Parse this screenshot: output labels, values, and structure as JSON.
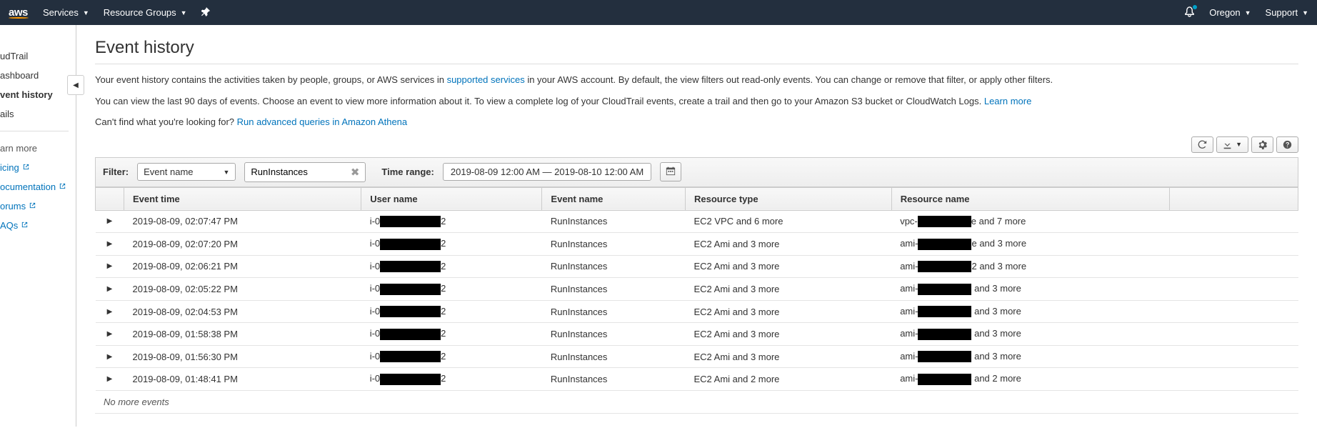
{
  "navbar": {
    "logo": "aws",
    "services": "Services",
    "resource_groups": "Resource Groups",
    "region": "Oregon",
    "support": "Support"
  },
  "sidebar": {
    "service_title": "udTrail",
    "dashboard": "ashboard",
    "event_history": "vent history",
    "trails": "ails",
    "learn_more": "arn more",
    "pricing": "icing",
    "documentation": "ocumentation",
    "forums": "orums",
    "faqs": "AQs"
  },
  "page": {
    "title": "Event history",
    "desc1_a": "Your event history contains the activities taken by people, groups, or AWS services in ",
    "desc1_link": "supported services",
    "desc1_b": " in your AWS account. By default, the view filters out read-only events. You can change or remove that filter, or apply other filters.",
    "desc2_a": "You can view the last 90 days of events. Choose an event to view more information about it. To view a complete log of your CloudTrail events, create a trail and then go to your Amazon S3 bucket or CloudWatch Logs. ",
    "desc2_link": "Learn more",
    "desc3_a": "Can't find what you're looking for? ",
    "desc3_link": "Run advanced queries in Amazon Athena"
  },
  "filter": {
    "label": "Filter:",
    "attribute": "Event name",
    "value": "RunInstances",
    "timerange_label": "Time range:",
    "timerange_value": "2019-08-09 12:00 AM — 2019-08-10 12:00 AM"
  },
  "table": {
    "headers": {
      "event_time": "Event time",
      "user_name": "User name",
      "event_name": "Event name",
      "resource_type": "Resource type",
      "resource_name": "Resource name"
    },
    "rows": [
      {
        "time": "2019-08-09, 02:07:47 PM",
        "user_pre": "i-0",
        "user_post": "2",
        "event": "RunInstances",
        "rtype": "EC2 VPC and 6 more",
        "rname_pre": "vpc-",
        "rname_post": "e and 7 more"
      },
      {
        "time": "2019-08-09, 02:07:20 PM",
        "user_pre": "i-0",
        "user_post": "2",
        "event": "RunInstances",
        "rtype": "EC2 Ami and 3 more",
        "rname_pre": "ami-",
        "rname_post": "e and 3 more"
      },
      {
        "time": "2019-08-09, 02:06:21 PM",
        "user_pre": "i-0",
        "user_post": "2",
        "event": "RunInstances",
        "rtype": "EC2 Ami and 3 more",
        "rname_pre": "ami-",
        "rname_post": "2 and 3 more"
      },
      {
        "time": "2019-08-09, 02:05:22 PM",
        "user_pre": "i-0",
        "user_post": "2",
        "event": "RunInstances",
        "rtype": "EC2 Ami and 3 more",
        "rname_pre": "ami-",
        "rname_post": " and 3 more"
      },
      {
        "time": "2019-08-09, 02:04:53 PM",
        "user_pre": "i-0",
        "user_post": "2",
        "event": "RunInstances",
        "rtype": "EC2 Ami and 3 more",
        "rname_pre": "ami-",
        "rname_post": " and 3 more"
      },
      {
        "time": "2019-08-09, 01:58:38 PM",
        "user_pre": "i-0",
        "user_post": "2",
        "event": "RunInstances",
        "rtype": "EC2 Ami and 3 more",
        "rname_pre": "ami-",
        "rname_post": " and 3 more"
      },
      {
        "time": "2019-08-09, 01:56:30 PM",
        "user_pre": "i-0",
        "user_post": "2",
        "event": "RunInstances",
        "rtype": "EC2 Ami and 3 more",
        "rname_pre": "ami-",
        "rname_post": " and 3 more"
      },
      {
        "time": "2019-08-09, 01:48:41 PM",
        "user_pre": "i-0",
        "user_post": "2",
        "event": "RunInstances",
        "rtype": "EC2 Ami and 2 more",
        "rname_pre": "ami-",
        "rname_post": " and 2 more"
      }
    ],
    "no_more": "No more events"
  }
}
